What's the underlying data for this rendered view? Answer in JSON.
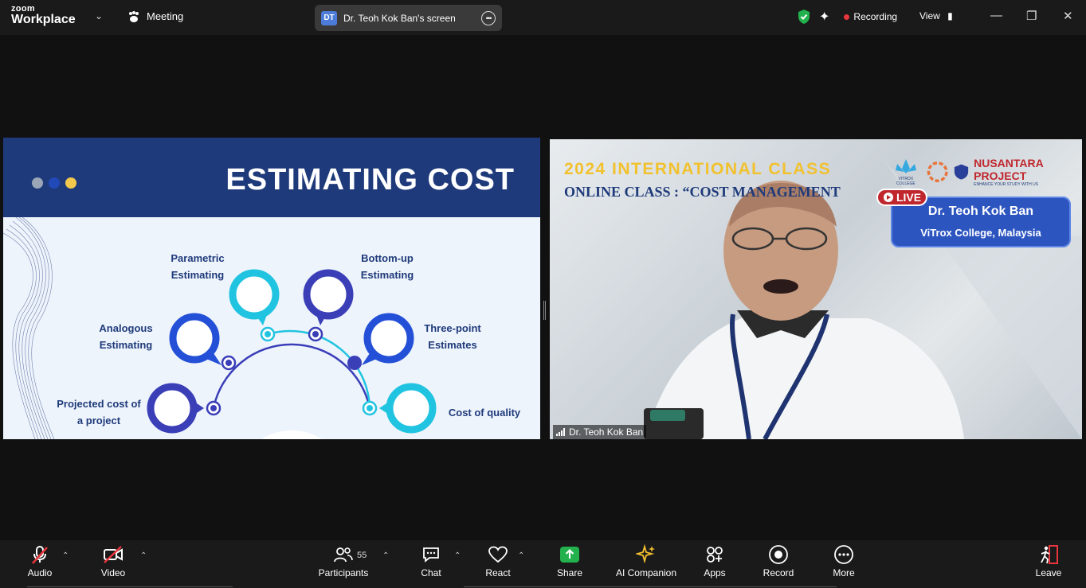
{
  "app": {
    "brand_top": "zoom",
    "brand_bottom": "Workplace",
    "meeting_label": "Meeting",
    "screen_initials": "DT",
    "screen_share_label": "Dr. Teoh Kok Ban's screen",
    "recording_label": "Recording",
    "view_label": "View",
    "colors": {
      "recording": "#e8363d",
      "shield": "#22b14c",
      "share": "#22b14c"
    }
  },
  "slide": {
    "title": "ESTIMATING COST",
    "items": [
      {
        "label_l1": "Projected cost of",
        "label_l2": "a project"
      },
      {
        "label_l1": "Analogous",
        "label_l2": "Estimating"
      },
      {
        "label_l1": "Parametric",
        "label_l2": "Estimating"
      },
      {
        "label_l1": "Bottom-up",
        "label_l2": "Estimating"
      },
      {
        "label_l1": "Three-point",
        "label_l2": "Estimates"
      },
      {
        "label_l1": "Cost of quality",
        "label_l2": ""
      }
    ]
  },
  "video": {
    "banner_line1": "2024 INTERNATIONAL CLASS",
    "banner_line2": "ONLINE CLASS : “COST MANAGEMENT",
    "logo1_text": "VITROX COLLEGE",
    "logo3_text": "NUSANTARA PROJECT",
    "logo3_sub": "ENHANCE YOUR STUDY WITH US",
    "live_label": "LIVE",
    "card_name": "Dr. Teoh Kok Ban",
    "card_org": "ViTrox College, Malaysia",
    "speaker_name": "Dr. Teoh Kok Ban"
  },
  "toolbar": {
    "audio": "Audio",
    "video": "Video",
    "participants": "Participants",
    "participants_count": "55",
    "chat": "Chat",
    "react": "React",
    "share": "Share",
    "ai_companion": "AI Companion",
    "apps": "Apps",
    "record": "Record",
    "more": "More",
    "leave": "Leave"
  }
}
